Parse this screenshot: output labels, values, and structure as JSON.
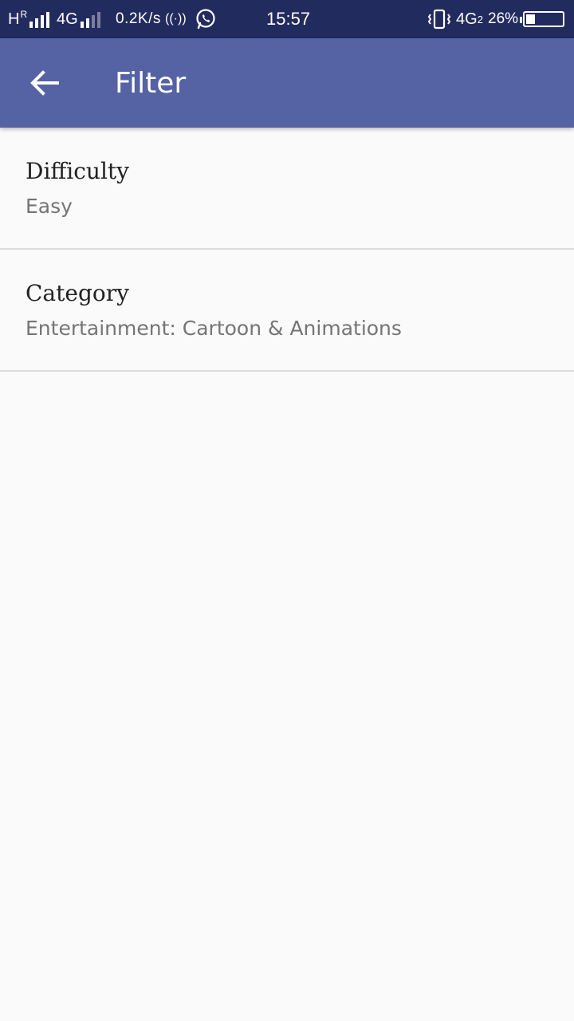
{
  "status_bar": {
    "carrier1_label": "H",
    "carrier1_roaming": "R",
    "carrier2_label": "4G",
    "net_speed": "0.2K/s",
    "hotspot_glyph": "((·))",
    "time": "15:57",
    "net2_label": "4G",
    "net2_sim": "2",
    "battery_percent": "26%",
    "battery_level": 0.26,
    "icons": [
      "signal-icon",
      "hotspot-icon",
      "whatsapp-icon",
      "vibrate-icon",
      "battery-icon"
    ]
  },
  "app_bar": {
    "title": "Filter",
    "back_icon": "arrow-back-icon",
    "color": "#5562a3"
  },
  "filters": [
    {
      "title": "Difficulty",
      "value": "Easy"
    },
    {
      "title": "Category",
      "value": "Entertainment: Cartoon & Animations"
    }
  ],
  "colors": {
    "status_bar": "#222b5e",
    "background": "#fafafa",
    "divider": "#dcdcdc",
    "primary_text": "#222222",
    "secondary_text": "#757575"
  }
}
